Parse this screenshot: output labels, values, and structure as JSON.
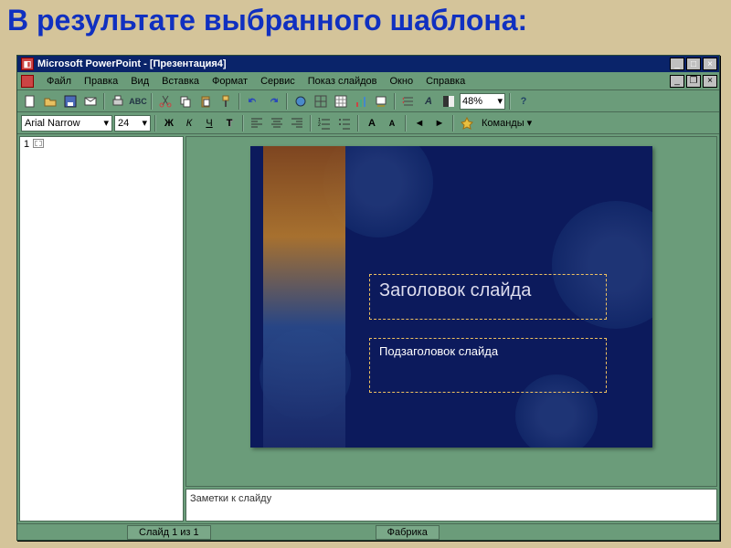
{
  "page": {
    "heading": "В результате выбранного шаблона:"
  },
  "titlebar": {
    "app": "Microsoft PowerPoint - [Презентация4]"
  },
  "menubar": {
    "items": [
      "Файл",
      "Правка",
      "Вид",
      "Вставка",
      "Формат",
      "Сервис",
      "Показ слайдов",
      "Окно",
      "Справка"
    ]
  },
  "toolbar1": {
    "zoom": "48%"
  },
  "toolbar2": {
    "font": "Arial Narrow",
    "size": "24",
    "commands_label": "Команды ▾"
  },
  "outline": {
    "items": [
      {
        "num": "1",
        "label": ""
      }
    ]
  },
  "slide": {
    "title_placeholder": "Заголовок слайда",
    "subtitle_placeholder": "Подзаголовок слайда"
  },
  "notes": {
    "placeholder": "Заметки к слайду"
  },
  "status": {
    "slide_counter": "Слайд 1 из 1",
    "template_name": "Фабрика"
  }
}
